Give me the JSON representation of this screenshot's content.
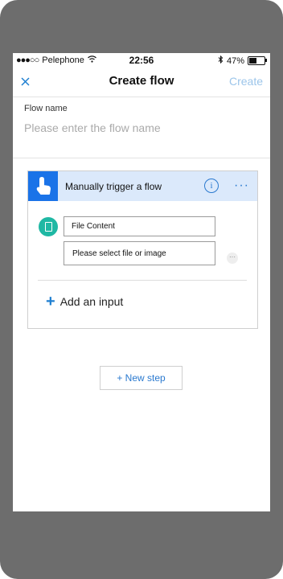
{
  "status_bar": {
    "carrier": "Pelephone",
    "time": "22:56",
    "battery": "47%",
    "battery_level": 0.47
  },
  "nav": {
    "title": "Create flow",
    "create_label": "Create"
  },
  "flow_name": {
    "label": "Flow name",
    "placeholder": "Please enter the flow name",
    "value": ""
  },
  "trigger_card": {
    "title": "Manually trigger a flow",
    "inputs": {
      "field_label": "File Content",
      "field_placeholder": "Please select file or image"
    },
    "add_input_label": "Add an input",
    "icons": [
      "touch-icon",
      "info-icon",
      "more-options-icon",
      "file-icon"
    ]
  },
  "new_step_label": "+ New step",
  "colors": {
    "accent": "#1a73e8",
    "link": "#2a79cf",
    "header_bg": "#dbe9fb",
    "file_avatar": "#1fb8a4",
    "create_disabled": "#9cc5ea"
  }
}
